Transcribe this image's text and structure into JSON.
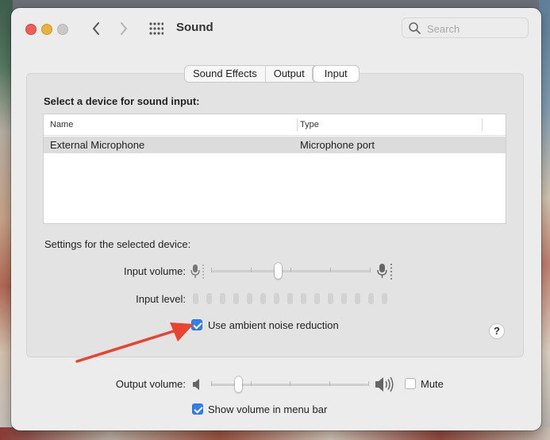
{
  "window": {
    "title": "Sound",
    "search_placeholder": "Search"
  },
  "tabs": [
    {
      "label": "Sound Effects",
      "active": false
    },
    {
      "label": "Output",
      "active": false
    },
    {
      "label": "Input",
      "active": true
    }
  ],
  "input": {
    "section_label": "Select a device for sound input:",
    "columns": [
      "Name",
      "Type"
    ],
    "devices": [
      {
        "name": "External Microphone",
        "type": "Microphone port",
        "selected": true
      }
    ],
    "settings_label": "Settings for the selected device:",
    "input_volume_label": "Input volume:",
    "input_volume_fraction": 0.42,
    "input_level_label": "Input level:",
    "input_level_bars_lit": 0,
    "ambient_noise_label": "Use ambient noise reduction",
    "ambient_noise_checked": true,
    "help_label": "?"
  },
  "output": {
    "volume_label": "Output volume:",
    "volume_fraction": 0.17,
    "mute_label": "Mute",
    "mute_checked": false,
    "show_volume_label": "Show volume in menu bar",
    "show_volume_checked": true
  },
  "colors": {
    "accent": "#2f7ff0",
    "annotation_arrow": "#e8442f"
  },
  "icons": [
    "back-icon",
    "forward-icon",
    "grid-icon",
    "search-icon",
    "microphone-icon",
    "speaker-icon"
  ]
}
